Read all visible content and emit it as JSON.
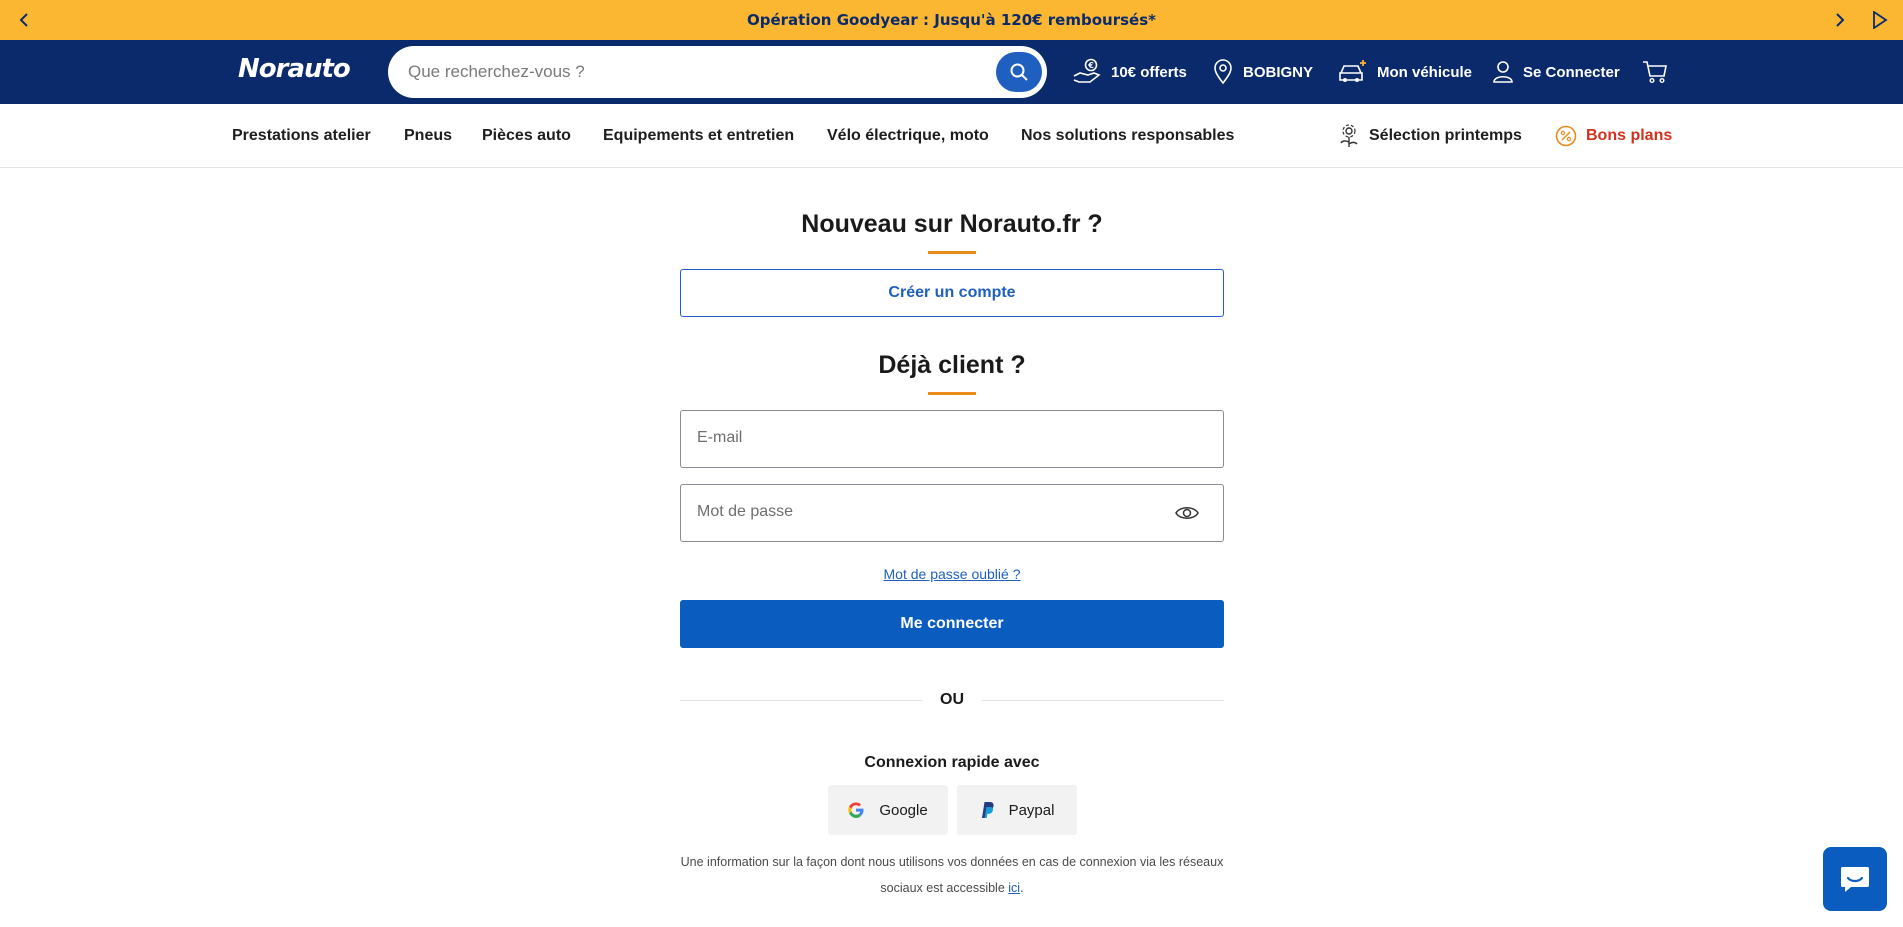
{
  "promo": {
    "text": "Opération Goodyear : Jusqu'à 120€ remboursés*"
  },
  "header": {
    "logo": "Norauto",
    "search": {
      "placeholder": "Que recherchez-vous ?"
    },
    "offer_label": "10€ offerts",
    "store_label": "BOBIGNY",
    "vehicle_label": "Mon véhicule",
    "login_label": "Se Connecter"
  },
  "nav": {
    "items": [
      "Prestations atelier",
      "Pneus",
      "Pièces auto",
      "Equipements et entretien",
      "Vélo électrique, moto",
      "Nos solutions responsables"
    ],
    "spring_label": "Sélection printemps",
    "deals_label": "Bons plans"
  },
  "register": {
    "title": "Nouveau sur Norauto.fr ?",
    "button_label": "Créer un compte"
  },
  "login": {
    "title": "Déjà client ?",
    "email_placeholder": "E-mail",
    "password_placeholder": "Mot de passe",
    "forgot_label": "Mot de passe oublié ?",
    "submit_label": "Me connecter",
    "or_label": "OU",
    "quick_title": "Connexion rapide avec",
    "google_label": "Google",
    "paypal_label": "Paypal",
    "info_text": "Une information sur la façon dont nous utilisons vos données en cas de connexion via les réseaux sociaux est accessible",
    "info_link": "ici",
    "info_end": "."
  },
  "colors": {
    "promo_bg": "#fbb632",
    "header_bg": "#0b2a6b",
    "primary": "#0a5cbf",
    "accent_underline": "#ea8a1a",
    "deals_red": "#d0321e"
  }
}
